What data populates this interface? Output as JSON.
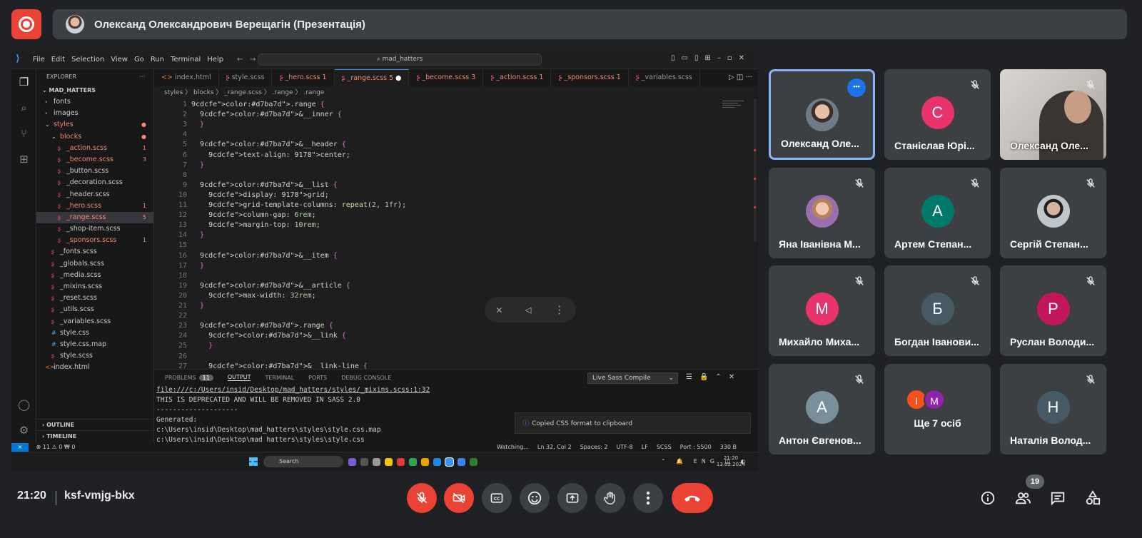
{
  "presenter": {
    "title": "Олександ Олександрович Верещагін (Презентація)"
  },
  "vscode": {
    "menu": [
      "File",
      "Edit",
      "Selection",
      "View",
      "Go",
      "Run",
      "Terminal",
      "Help"
    ],
    "search": "mad_hatters",
    "explorer_title": "EXPLORER",
    "project": "MAD_HATTERS",
    "files": [
      {
        "name": "fonts",
        "type": "folder",
        "depth": 0,
        "badge": ""
      },
      {
        "name": "images",
        "type": "folder",
        "depth": 0,
        "badge": ""
      },
      {
        "name": "styles",
        "type": "folder-open",
        "depth": 0,
        "badge": "●"
      },
      {
        "name": "blocks",
        "type": "folder-open",
        "depth": 1,
        "badge": "●"
      },
      {
        "name": "_action.scss",
        "type": "scss",
        "depth": 2,
        "badge": "1"
      },
      {
        "name": "_become.scss",
        "type": "scss",
        "depth": 2,
        "badge": "3"
      },
      {
        "name": "_button.scss",
        "type": "scss",
        "depth": 2,
        "badge": ""
      },
      {
        "name": "_decoration.scss",
        "type": "scss",
        "depth": 2,
        "badge": ""
      },
      {
        "name": "_header.scss",
        "type": "scss",
        "depth": 2,
        "badge": ""
      },
      {
        "name": "_hero.scss",
        "type": "scss",
        "depth": 2,
        "badge": "1"
      },
      {
        "name": "_range.scss",
        "type": "scss",
        "depth": 2,
        "badge": "5"
      },
      {
        "name": "_shop-item.scss",
        "type": "scss",
        "depth": 2,
        "badge": ""
      },
      {
        "name": "_sponsors.scss",
        "type": "scss",
        "depth": 2,
        "badge": "1"
      },
      {
        "name": "_fonts.scss",
        "type": "scss",
        "depth": 1,
        "badge": ""
      },
      {
        "name": "_globals.scss",
        "type": "scss",
        "depth": 1,
        "badge": ""
      },
      {
        "name": "_media.scss",
        "type": "scss",
        "depth": 1,
        "badge": ""
      },
      {
        "name": "_mixins.scss",
        "type": "scss",
        "depth": 1,
        "badge": ""
      },
      {
        "name": "_reset.scss",
        "type": "scss",
        "depth": 1,
        "badge": ""
      },
      {
        "name": "_utils.scss",
        "type": "scss",
        "depth": 1,
        "badge": ""
      },
      {
        "name": "_variables.scss",
        "type": "scss",
        "depth": 1,
        "badge": ""
      },
      {
        "name": "style.css",
        "type": "css",
        "depth": 1,
        "badge": ""
      },
      {
        "name": "style.css.map",
        "type": "css",
        "depth": 1,
        "badge": ""
      },
      {
        "name": "style.scss",
        "type": "scss",
        "depth": 1,
        "badge": ""
      },
      {
        "name": "index.html",
        "type": "html",
        "depth": 0,
        "badge": ""
      }
    ],
    "outline": "OUTLINE",
    "timeline": "TIMELINE",
    "tabs": [
      "index.html",
      "style.scss",
      "_hero.scss 1",
      "_range.scss 5",
      "_become.scss 3",
      "_action.scss 1",
      "_sponsors.scss 1",
      "_variables.scss"
    ],
    "active_tab": 3,
    "breadcrumb": "styles 〉 blocks 〉 _range.scss 〉 .range 〉 .range",
    "code": [
      ".range {",
      "  &__inner {",
      "  }",
      "",
      "  &__header {",
      "    text-align: center;",
      "  }",
      "",
      "  &__list {",
      "    display: grid;",
      "    grid-template-columns: repeat(2, 1fr);",
      "    column-gap: 6rem;",
      "    margin-top: 10rem;",
      "  }",
      "",
      "  &__item {",
      "  }",
      "",
      "  &__article {",
      "    max-width: 32rem;",
      "  }",
      "",
      "  .range {",
      "    &__link {",
      "    }",
      "",
      "    &__link-line {"
    ],
    "panel_tabs": [
      "PROBLEMS",
      "OUTPUT",
      "TERMINAL",
      "PORTS",
      "DEBUG CONSOLE"
    ],
    "problems_count": "11",
    "output_source": "Live Sass Compile",
    "output_lines": [
      "file:///c:/Users/insid/Desktop/mad_hatters/styles/_mixins.scss:1:32",
      "THIS IS DEPRECATED AND WILL BE REMOVED IN SASS 2.0",
      "--------------------",
      "Generated:",
      "c:\\Users\\insid\\Desktop\\mad_hatters\\styles\\style.css.map",
      "c:\\Users\\insid\\Desktop\\mad_hatters\\styles\\style.css"
    ],
    "toast": "Copied CSS format to clipboard",
    "status_left": "⊗ 11 ⚠ 0   ₩ 0",
    "status_right": [
      "Watching...",
      "Ln 32, Col 2",
      "Spaces: 2",
      "UTF-8",
      "LF",
      "SCSS",
      "Port : 5500",
      "330 B"
    ],
    "taskbar_search": "Search",
    "taskbar_time": "21:20",
    "taskbar_date": "13.02.2024",
    "taskbar_lang": "ENG"
  },
  "participants": [
    {
      "name": "Олександ Олександрович Верещагін",
      "short": "Олександ Оле...",
      "kind": "photo",
      "selected": true
    },
    {
      "name": "Станіслав Юрійович",
      "short": "Станіслав Юрі...",
      "initial": "С",
      "color": "#e8336d"
    },
    {
      "name": "Олександ Олександрович",
      "short": "Олександ Оле...",
      "kind": "camera"
    },
    {
      "name": "Яна Іванівна М...",
      "short": "Яна Іванівна М...",
      "kind": "photo"
    },
    {
      "name": "Артем Степанович",
      "short": "Артем Степан...",
      "initial": "А",
      "color": "#00796b"
    },
    {
      "name": "Сергій Степанович",
      "short": "Сергій Степан...",
      "kind": "photo"
    },
    {
      "name": "Михайло Михайлович",
      "short": "Михайло Миха...",
      "initial": "М",
      "color": "#e8336d"
    },
    {
      "name": "Богдан Іванович",
      "short": "Богдан Іванови...",
      "initial": "Б",
      "color": "#455a64"
    },
    {
      "name": "Руслан Володимирович",
      "short": "Руслан Володи...",
      "initial": "Р",
      "color": "#c2185b"
    },
    {
      "name": "Антон Євгенович",
      "short": "Антон Євгенов...",
      "initial": "А",
      "color": "#78909c"
    },
    {
      "name": "Ще 7 осіб",
      "short": "Ще 7 осіб",
      "kind": "more"
    },
    {
      "name": "Наталія Володимирівна",
      "short": "Наталія Волод...",
      "initial": "Н",
      "color": "#455a64"
    }
  ],
  "more_avatars": [
    {
      "initial": "І",
      "color": "#f4511e"
    },
    {
      "initial": "М",
      "color": "#8e24aa"
    }
  ],
  "meeting": {
    "time": "21:20",
    "code": "ksf-vmjg-bkx",
    "participant_count": "19"
  },
  "colors": {
    "danger": "#ea4335",
    "accent": "#8ab4f8",
    "tile": "#3c4043",
    "bg": "#202124"
  }
}
